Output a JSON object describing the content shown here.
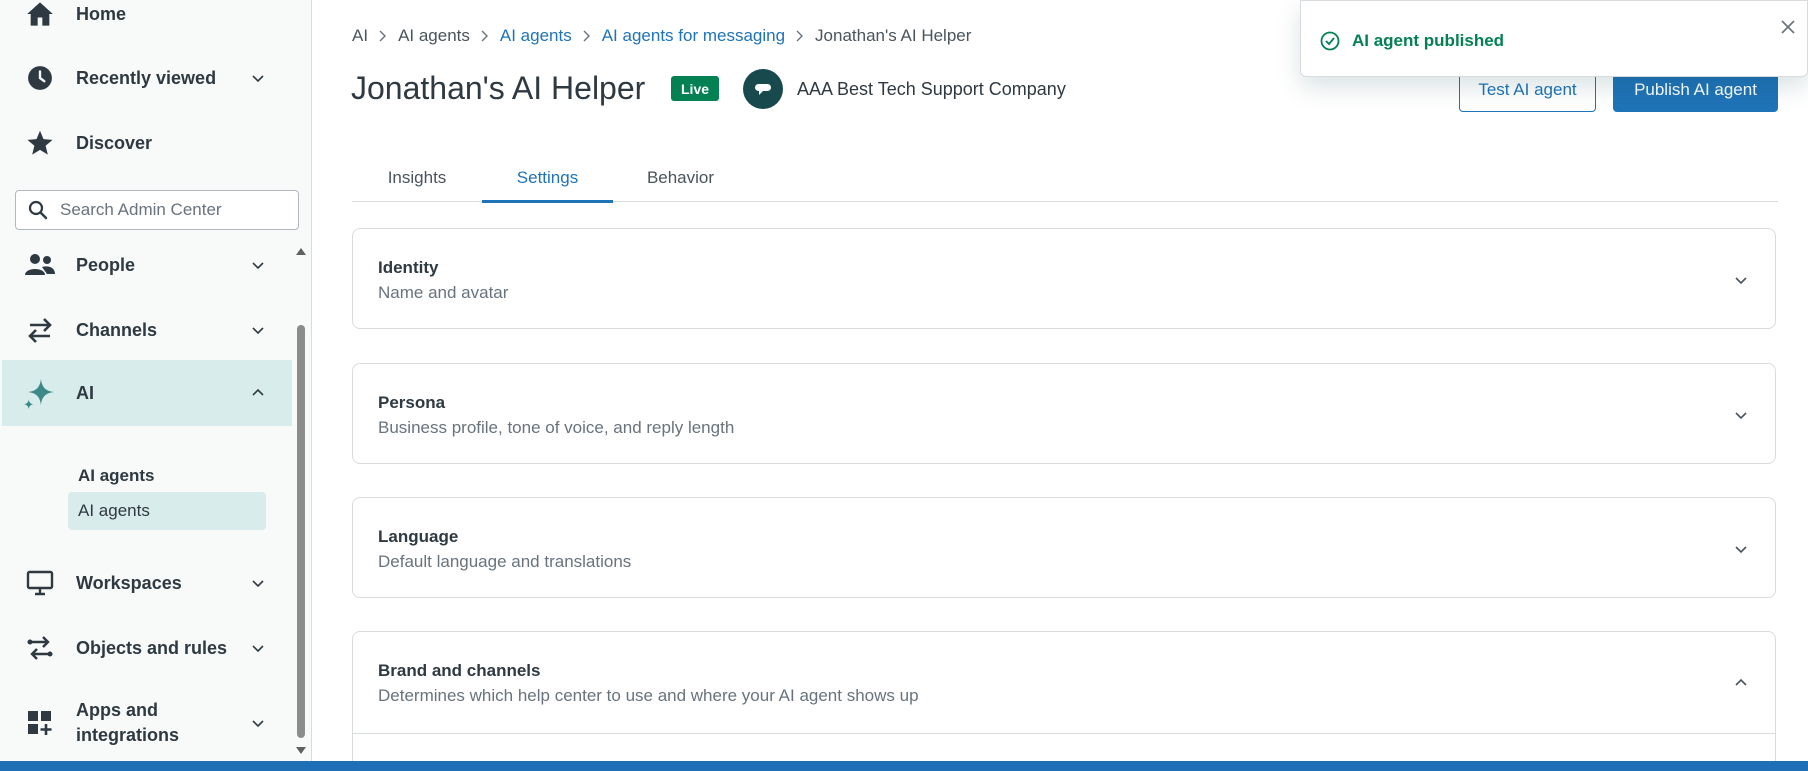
{
  "sidebar": {
    "items": [
      {
        "label": "Home",
        "icon": "home-icon"
      },
      {
        "label": "Recently viewed",
        "icon": "clock-icon"
      },
      {
        "label": "Discover",
        "icon": "star-icon"
      },
      {
        "label": "People",
        "icon": "people-icon"
      },
      {
        "label": "Channels",
        "icon": "arrows-icon"
      },
      {
        "label": "AI",
        "icon": "sparkle-icon"
      },
      {
        "label": "Workspaces",
        "icon": "monitor-icon"
      },
      {
        "label": "Objects and rules",
        "icon": "routing-icon"
      },
      {
        "label": "Apps and",
        "label2": "integrations",
        "icon": "apps-icon"
      }
    ],
    "search_placeholder": "Search Admin Center",
    "ai_section_header": "AI agents",
    "ai_sub_item": "AI agents"
  },
  "breadcrumb": [
    "AI",
    "AI agents",
    "AI agents",
    "AI agents for messaging",
    "Jonathan's AI Helper"
  ],
  "page": {
    "title": "Jonathan's AI Helper",
    "status_badge": "Live",
    "brand_name": "AAA Best Tech Support Company"
  },
  "actions": {
    "test_label": "Test AI agent",
    "publish_label": "Publish AI agent"
  },
  "toast": {
    "message": "AI agent published"
  },
  "tabs": [
    "Insights",
    "Settings",
    "Behavior"
  ],
  "active_tab": "Settings",
  "sections": [
    {
      "title": "Identity",
      "description": "Name and avatar"
    },
    {
      "title": "Persona",
      "description": "Business profile, tone of voice, and reply length"
    },
    {
      "title": "Language",
      "description": "Default language and translations"
    },
    {
      "title": "Brand and channels",
      "description": "Determines which help center to use and where your AI agent shows up"
    }
  ],
  "colors": {
    "accent": "#1f73b7",
    "success": "#038153",
    "active_nav_bg": "#d9ecec",
    "brand_avatar": "#17494d"
  }
}
